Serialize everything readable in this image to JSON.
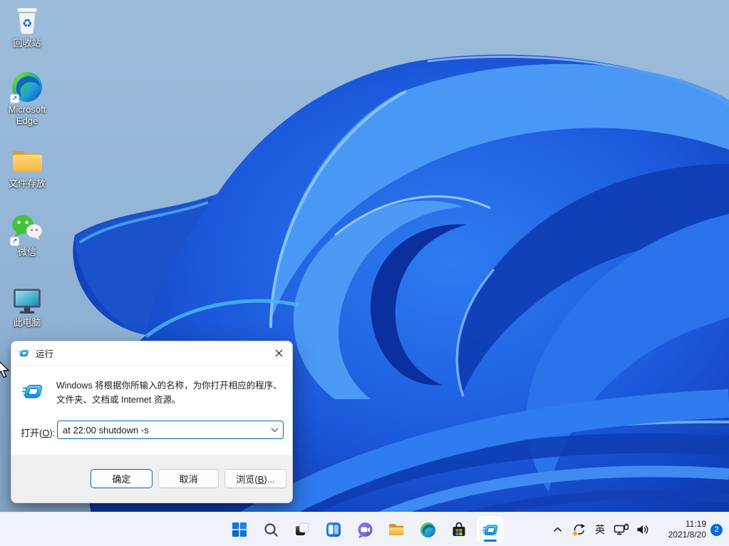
{
  "desktop": {
    "icons": [
      {
        "label": "回收站"
      },
      {
        "label": "Microsoft Edge"
      },
      {
        "label": "文件存放"
      },
      {
        "label": "微信"
      },
      {
        "label": "此电脑"
      }
    ]
  },
  "run_dialog": {
    "title": "运行",
    "description_line1": "Windows 将根据你所输入的名称，为你打开相应的程序、",
    "description_line2": "文件夹、文档或 Internet 资源。",
    "open_label": {
      "prefix": "打开(",
      "mnemonic": "O",
      "suffix": "):"
    },
    "input_value": "at 22:00 shutdown -s",
    "buttons": {
      "ok": "确定",
      "cancel": "取消",
      "browse": {
        "prefix": "浏览(",
        "mnemonic": "B",
        "suffix": ")..."
      }
    }
  },
  "taskbar": {
    "buttons": [
      "start",
      "search",
      "task-view",
      "widgets",
      "chat",
      "file-explorer",
      "edge",
      "store",
      "run-active"
    ],
    "tray": {
      "ime": "英",
      "time": "11:19",
      "date": "2021/8/20",
      "notification_count": "2"
    }
  },
  "icons": {
    "recycle_glyph": "♻",
    "shortcut_arrow_glyph": "↗"
  },
  "colors": {
    "accent": "#0067c0",
    "badge": "#0a6bd7",
    "taskbar_bg": "#eff3f9",
    "wallpaper_sky": "#93b6d7",
    "bloom_blue": "#2e7cf0"
  }
}
